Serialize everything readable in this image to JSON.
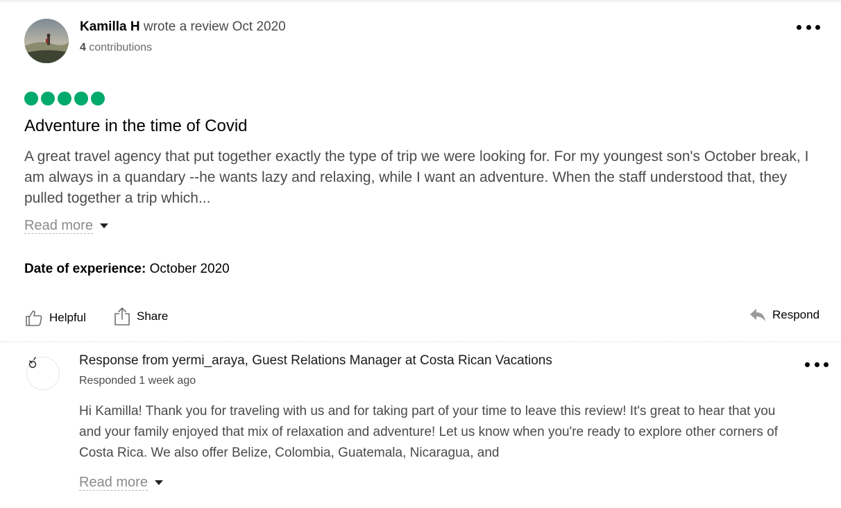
{
  "review": {
    "author": {
      "name": "Kamilla H",
      "action": "wrote a review Oct 2020",
      "contributions_count": "4",
      "contributions_label": "contributions"
    },
    "rating": 5,
    "rating_max": 5,
    "rating_color": "#00aa6c",
    "title": "Adventure in the time of Covid",
    "text": "A great travel agency that put together exactly the type of trip we were looking for. For my youngest son's October break, I am always in a quandary --he wants lazy and relaxing, while I want an adventure. When the staff understood that, they pulled together a trip which...",
    "read_more_label": "Read more",
    "date_of_experience_label": "Date of experience:",
    "date_of_experience_value": "October 2020",
    "actions": {
      "helpful_label": "Helpful",
      "share_label": "Share",
      "respond_label": "Respond"
    },
    "icons": {
      "more": "more-options-icon",
      "helpful": "thumbs-up-icon",
      "share": "share-icon",
      "respond": "reply-arrow-icon"
    }
  },
  "response": {
    "title": "Response from yermi_araya, Guest Relations Manager at Costa Rican Vacations",
    "date": "Responded 1 week ago",
    "text": "Hi Kamilla! Thank you for traveling with us and for taking part of your time to leave this review! It's great to hear that you and your family enjoyed that mix of relaxation and adventure! Let us know when you're ready to explore other corners of Costa Rica. We also offer Belize, Colombia, Guatemala, Nicaragua, and",
    "read_more_label": "Read more",
    "icons": {
      "avatar": "manager-avatar-icon",
      "more": "more-options-icon"
    }
  }
}
